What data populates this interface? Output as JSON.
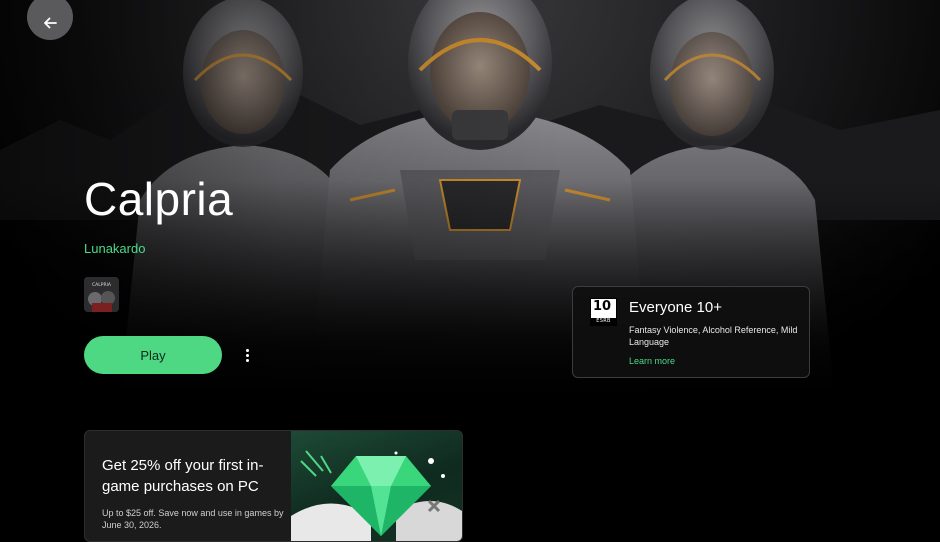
{
  "game": {
    "title": "Calpria",
    "developer": "Lunakardo",
    "icon_text": "CALPRIA",
    "play_label": "Play"
  },
  "rating": {
    "board_age": "10",
    "board_label": "ESRB",
    "title": "Everyone 10+",
    "descriptors": "Fantasy Violence, Alcohol Reference, Mild Language",
    "link": "Learn more"
  },
  "promo": {
    "title": "Get 25% off your first in-game purchases on PC",
    "description": "Up to $25 off. Save now and use in games by June 30, 2026."
  },
  "colors": {
    "accent": "#4fd884",
    "link": "#4cd98a",
    "background": "#000000"
  },
  "icons": {
    "back": "arrow-left-icon",
    "more": "more-vert-icon"
  }
}
